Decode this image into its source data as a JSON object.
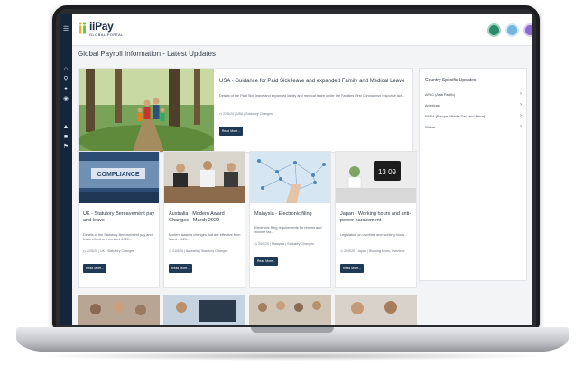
{
  "app": {
    "logo_text": "iiPay",
    "logo_sub": "GLOBAL PORTAL"
  },
  "page_title": "Global Payroll Information - Latest Updates",
  "featured": {
    "title": "USA - Guidance for Paid Sick leave and expanded Family and Medical Leave",
    "text": "Details of the Paid Sick leave and expanded family and medical leave under the Families First Coronavirus response act....",
    "meta": "22/5/20 | USA | Statutory Changes",
    "button": "Read More..."
  },
  "cards": [
    {
      "title": "UK - Statutory Bereavement pay and leave",
      "text": "Details of the Statutory Bereavement pay and leave effective from April 2020...",
      "meta": "22/5/20 | UK | Statutory Changes",
      "button": "Read More..."
    },
    {
      "title": "Australia - Modern Award Changes - March 2020",
      "text": "Modern Awards changes that are effective from March 2020...",
      "meta": "21/5/20 | Australia | Statutory Changes",
      "button": "Read More..."
    },
    {
      "title": "Malaysia - Electronic filing",
      "text": "Electronic filing requirements for returns and income tax...",
      "meta": "20/5/20 | Malaysia | Statutory Changes",
      "button": "Read More..."
    },
    {
      "title": "Japan - Working hours and anti-power harassment",
      "text": "Legislation on overtime and working hours...",
      "meta": "20/5/20 | Japan | Working hours, Overtime",
      "button": "Read More..."
    }
  ],
  "country_updates": {
    "title": "Country Specific Updates",
    "items": [
      "APAC (Asia Pacific)",
      "Americas",
      "EMEA (Europe, Middle East and Africa)",
      "Global"
    ]
  },
  "image_labels": {
    "compliance": "COMPLIANCE",
    "clock": "13 09"
  },
  "colors": {
    "sidebar": "#16263a",
    "button": "#1f3a55",
    "logo_yellow": "#f2b318",
    "logo_green": "#6bbf44"
  }
}
